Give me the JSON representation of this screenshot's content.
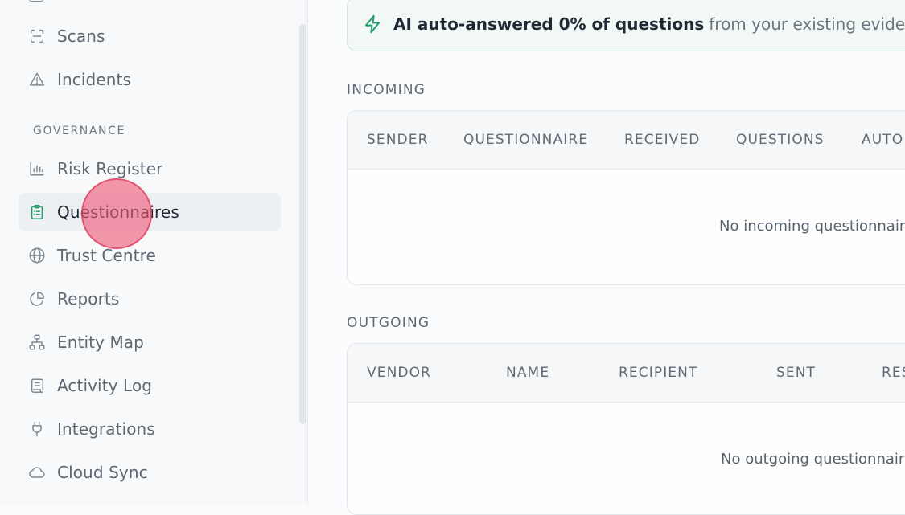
{
  "sidebar": {
    "items_top": [
      {
        "label": "Scans",
        "icon": "scan-icon"
      },
      {
        "label": "Incidents",
        "icon": "alert-triangle-icon"
      }
    ],
    "section_label": "GOVERNANCE",
    "items": [
      {
        "label": "Risk Register",
        "icon": "bar-chart-icon"
      },
      {
        "label": "Questionnaires",
        "icon": "clipboard-list-icon",
        "active": true
      },
      {
        "label": "Trust Centre",
        "icon": "globe-icon"
      },
      {
        "label": "Reports",
        "icon": "pie-chart-icon"
      },
      {
        "label": "Entity Map",
        "icon": "network-icon"
      },
      {
        "label": "Activity Log",
        "icon": "scroll-text-icon"
      },
      {
        "label": "Integrations",
        "icon": "plug-icon"
      },
      {
        "label": "Cloud Sync",
        "icon": "cloud-icon"
      }
    ]
  },
  "banner": {
    "icon": "zap-icon",
    "strong": "AI auto-answered 0% of questions",
    "rest": "from your existing evidenc"
  },
  "incoming": {
    "title": "INCOMING",
    "columns": [
      "SENDER",
      "QUESTIONNAIRE",
      "RECEIVED",
      "QUESTIONS",
      "AUTO"
    ],
    "empty": "No incoming questionnair"
  },
  "outgoing": {
    "title": "OUTGOING",
    "columns": [
      "VENDOR",
      "NAME",
      "RECIPIENT",
      "SENT",
      "RES"
    ],
    "empty": "No outgoing questionnair"
  },
  "colors": {
    "accent": "#1f9d6b",
    "active_bg": "#edf0f3",
    "cursor": "#ef5a78"
  }
}
